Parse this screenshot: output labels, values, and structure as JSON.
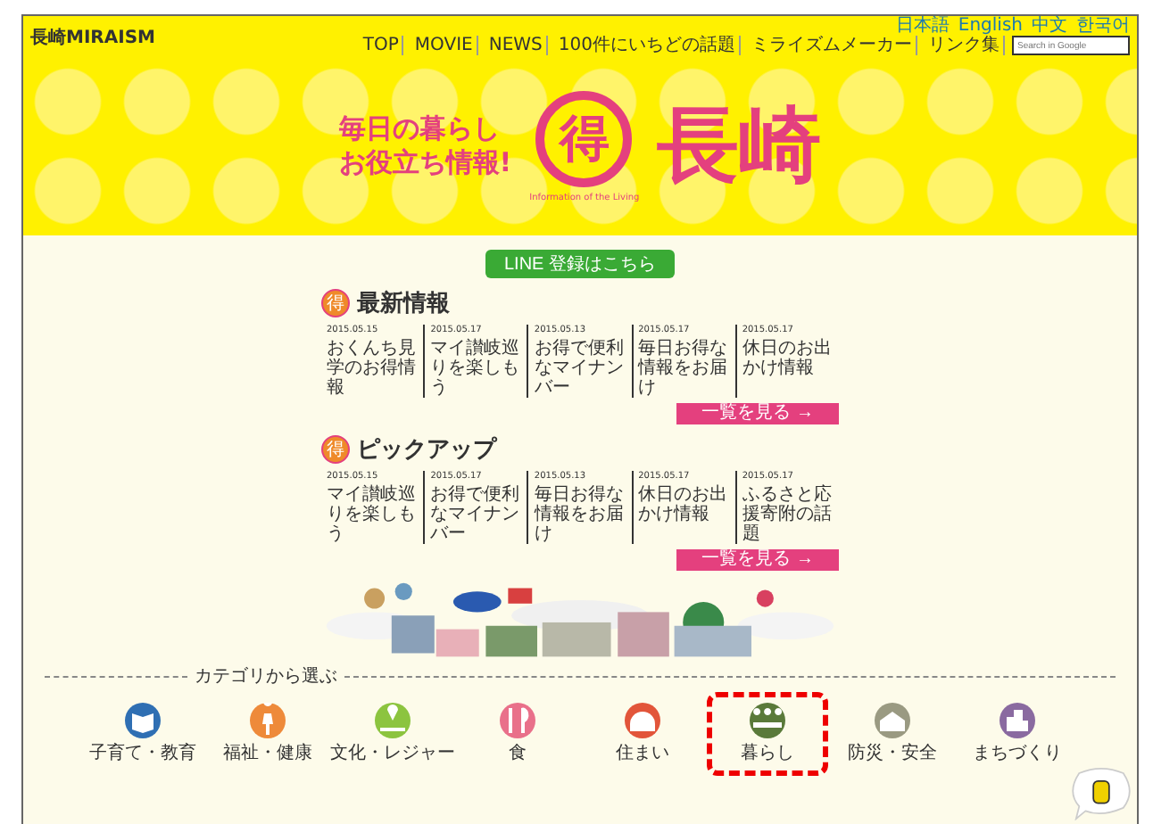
{
  "header": {
    "logo": "長崎MIRAISM",
    "nav": [
      "TOP",
      "MOVIE",
      "NEWS",
      "100件にいちどの話題",
      "ミライズムメーカー",
      "リンク集"
    ],
    "languages": [
      "日本語",
      "English",
      "中文",
      "한국어"
    ],
    "search": {
      "placeholder": "Search in Google"
    }
  },
  "hero": {
    "tagline_1": "毎日の暮らし",
    "tagline_2": "お役立ち情報!",
    "badge": "得",
    "title": "長崎",
    "subtitle": "Information of the Living"
  },
  "line_button": {
    "label": "LINE 登録はこちら"
  },
  "sections": [
    {
      "title": "最新情報",
      "badge": "得",
      "items": [
        {
          "date": "2015.05.15",
          "text": "おくんち見学のお得情報"
        },
        {
          "date": "2015.05.17",
          "text": "マイ讃岐巡りを楽しもう"
        },
        {
          "date": "2015.05.13",
          "text": "お得で便利なマイナンバー"
        },
        {
          "date": "2015.05.17",
          "text": "毎日お得な情報をお届け"
        },
        {
          "date": "2015.05.17",
          "text": "休日のお出かけ情報"
        }
      ],
      "more": "一覧を見る →"
    },
    {
      "title": "ピックアップ",
      "badge": "得",
      "items": [
        {
          "date": "2015.05.15",
          "text": "マイ讃岐巡りを楽しもう"
        },
        {
          "date": "2015.05.17",
          "text": "お得で便利なマイナンバー"
        },
        {
          "date": "2015.05.13",
          "text": "毎日お得な情報をお届け"
        },
        {
          "date": "2015.05.17",
          "text": "休日のお出かけ情報"
        },
        {
          "date": "2015.05.17",
          "text": "ふるさと応援寄附の話題"
        }
      ],
      "more": "一覧を見る →"
    }
  ],
  "categories": {
    "heading": "カテゴリから選ぶ",
    "items": [
      {
        "label": "子育て・教育",
        "kind": "book",
        "color": "#2f6fb3",
        "highlighted": false
      },
      {
        "label": "福祉・健康",
        "kind": "person",
        "color": "#ee8a3a",
        "highlighted": false
      },
      {
        "label": "文化・レジャー",
        "kind": "map",
        "color": "#8cc43f",
        "highlighted": false
      },
      {
        "label": "食",
        "kind": "fork",
        "color": "#e9708a",
        "highlighted": false
      },
      {
        "label": "住まい",
        "kind": "house",
        "color": "#e2553a",
        "highlighted": false
      },
      {
        "label": "暮らし",
        "kind": "people",
        "color": "#5a7a3a",
        "highlighted": true
      },
      {
        "label": "防災・安全",
        "kind": "building",
        "color": "#9a9a82",
        "highlighted": false
      },
      {
        "label": "まちづくり",
        "kind": "town",
        "color": "#8a6aa0",
        "highlighted": false
      }
    ]
  }
}
